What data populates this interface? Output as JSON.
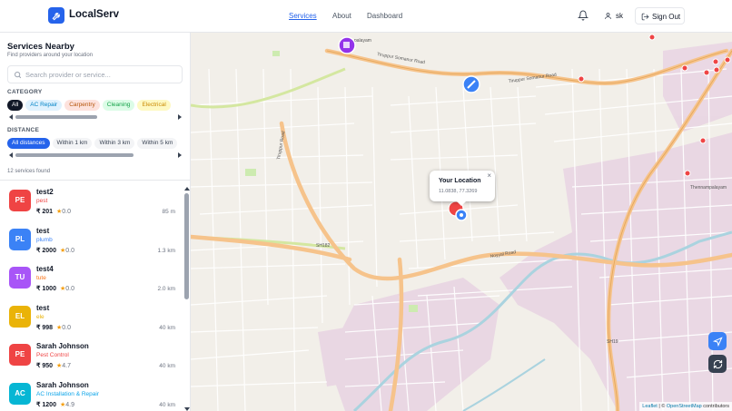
{
  "header": {
    "brand": "LocalServ",
    "nav": [
      {
        "label": "Services",
        "active": true
      },
      {
        "label": "About",
        "active": false
      },
      {
        "label": "Dashboard",
        "active": false
      }
    ],
    "user_name": "sk",
    "sign_out_label": "Sign Out"
  },
  "sidebar": {
    "title": "Services Nearby",
    "subtitle": "Find providers around your location",
    "search_placeholder": "Search provider or service...",
    "category_label": "CATEGORY",
    "categories": [
      {
        "label": "All",
        "selected": true
      },
      {
        "label": "AC Repair",
        "selected": false
      },
      {
        "label": "Carpentry",
        "selected": false
      },
      {
        "label": "Cleaning",
        "selected": false
      },
      {
        "label": "Electrical",
        "selected": false
      }
    ],
    "distance_label": "DISTANCE",
    "distances": [
      {
        "label": "All distances",
        "selected": true
      },
      {
        "label": "Within 1 km",
        "selected": false
      },
      {
        "label": "Within 3 km",
        "selected": false
      },
      {
        "label": "Within 5 km",
        "selected": false
      }
    ],
    "results_count": "12 services found",
    "services": [
      {
        "initials": "PE",
        "name": "test2",
        "category": "pest",
        "price": "₹ 201",
        "rating": "0.0",
        "distance": "85 m",
        "color": "#ef4444"
      },
      {
        "initials": "PL",
        "name": "test",
        "category": "plumb",
        "price": "₹ 2000",
        "rating": "0.0",
        "distance": "1.3 km",
        "color": "#3b82f6"
      },
      {
        "initials": "TU",
        "name": "test4",
        "category": "tute",
        "price": "₹ 1000",
        "rating": "0.0",
        "distance": "2.0 km",
        "color": "#a855f7"
      },
      {
        "initials": "EL",
        "name": "test",
        "category": "ele",
        "price": "₹ 998",
        "rating": "0.0",
        "distance": "40 km",
        "color": "#eab308"
      },
      {
        "initials": "PE",
        "name": "Sarah Johnson",
        "category": "Pest Control",
        "price": "₹ 950",
        "rating": "4.7",
        "distance": "40 km",
        "color": "#ef4444"
      },
      {
        "initials": "AC",
        "name": "Sarah Johnson",
        "category": "AC Installation & Repair",
        "price": "₹ 1200",
        "rating": "4.9",
        "distance": "40 km",
        "color": "#06b6d4"
      }
    ]
  },
  "map": {
    "popup_title": "Your Location",
    "popup_coords": "11.0838, 77.3269",
    "popup_close": "×",
    "attribution_link1": "Leaflet",
    "attribution_sep": "| ©",
    "attribution_link2": "OpenStreetMap",
    "attribution_suffix": "contributors",
    "road_labels": [
      {
        "text": "Tiruppur Somanur Road"
      },
      {
        "text": "Tiruppur Somanur Road"
      },
      {
        "text": "Tiruppur Road"
      },
      {
        "text": "SH182"
      },
      {
        "text": "Noyyal Road"
      },
      {
        "text": "SH19"
      },
      {
        "text": "Thennampalayam"
      },
      {
        "text": "palayam"
      }
    ]
  },
  "colors": {
    "accent": "#2563eb",
    "road_major": "#f9b26b",
    "water": "#aad3df",
    "residential": "#e8d6e4"
  }
}
